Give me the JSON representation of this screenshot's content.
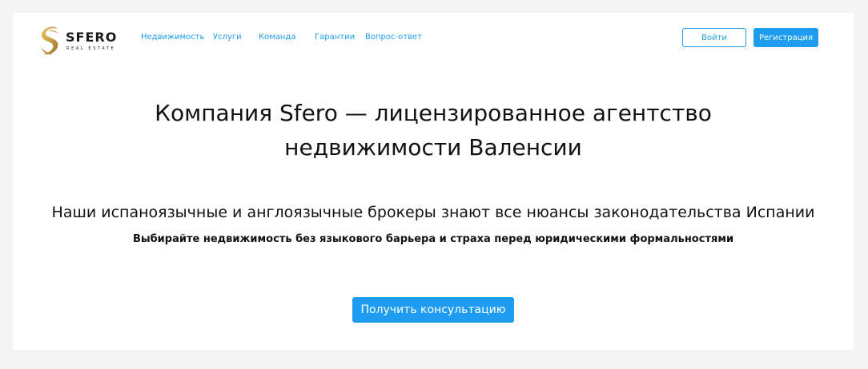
{
  "brand": {
    "name": "SFERO",
    "subtitle": "REAL ESTATE",
    "logo_icon": "sfero-logo-icon",
    "colors": {
      "gold": "#c9a047",
      "gold_dark": "#a8782a"
    }
  },
  "nav": {
    "items": [
      {
        "label": "Недвижимость"
      },
      {
        "label": "Услуги"
      },
      {
        "label": "Команда"
      },
      {
        "label": "Гарантии"
      },
      {
        "label": "Вопрос-ответ"
      }
    ]
  },
  "auth": {
    "login_label": "Войти",
    "register_label": "Регистрация"
  },
  "hero": {
    "title_line1": "Компания Sfero — лицензированное агентство",
    "title_line2": "недвижимости Валенсии",
    "subtitle": "Наши испаноязычные и англоязычные брокеры знают все нюансы законодательства Испании",
    "tagline": "Выбирайте недвижимость без языкового барьера и страха перед юридическими формальностями",
    "cta_label": "Получить консультацию"
  },
  "colors": {
    "accent": "#1d9cf0",
    "background": "#f4f4f4",
    "card": "#ffffff",
    "text": "#111111"
  }
}
